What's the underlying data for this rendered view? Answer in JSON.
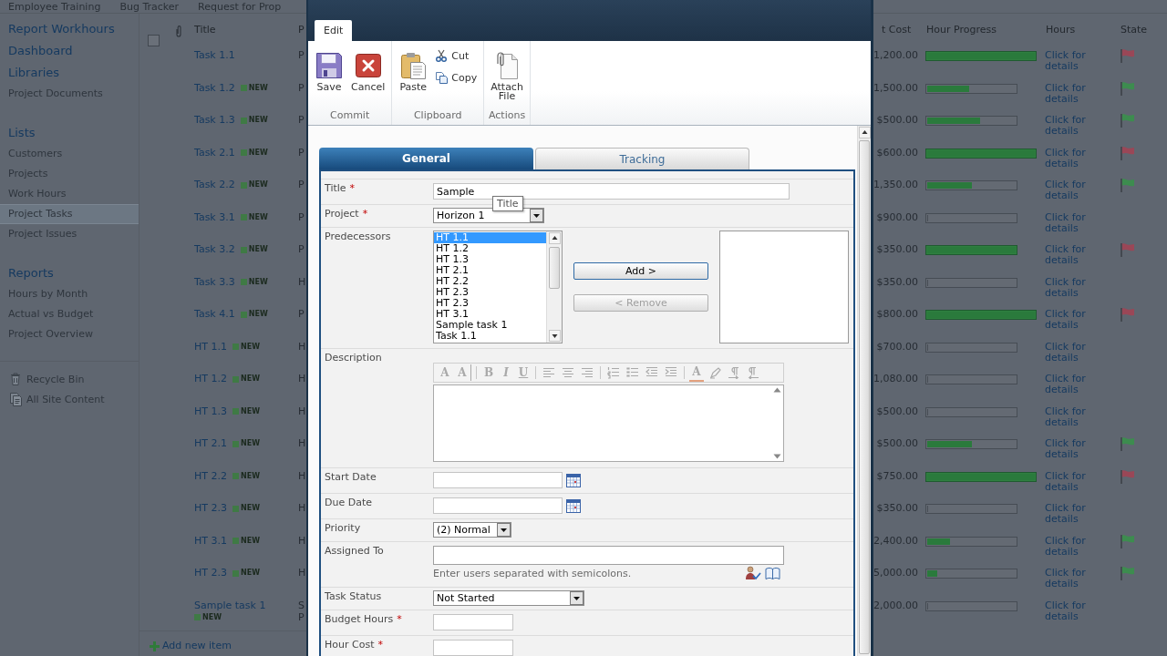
{
  "top_nav": [
    {
      "label": "Employee Training"
    },
    {
      "label": "Bug Tracker"
    },
    {
      "label": "Request for Prop"
    }
  ],
  "sidebar": {
    "groups": [
      {
        "headings": [
          "Report Workhours",
          "Dashboard",
          "Libraries"
        ],
        "items": [
          {
            "label": "Project Documents",
            "selected": false
          }
        ]
      },
      {
        "headings": [
          "Lists"
        ],
        "items": [
          {
            "label": "Customers",
            "selected": false
          },
          {
            "label": "Projects",
            "selected": false
          },
          {
            "label": "Work Hours",
            "selected": false
          },
          {
            "label": "Project Tasks",
            "selected": true
          },
          {
            "label": "Project Issues",
            "selected": false
          }
        ]
      },
      {
        "headings": [
          "Reports"
        ],
        "items": [
          {
            "label": "Hours by Month",
            "selected": false
          },
          {
            "label": "Actual vs Budget",
            "selected": false
          },
          {
            "label": "Project Overview",
            "selected": false
          }
        ]
      }
    ],
    "footer_links": [
      {
        "label": "Recycle Bin",
        "kind": "recycle_bin"
      },
      {
        "label": "All Site Content",
        "kind": "site_content"
      }
    ]
  },
  "list": {
    "select_all": {
      "checked": false
    },
    "columns": {
      "title": "Title",
      "column_2": "P",
      "column_cost": "t Cost",
      "progress": "Hour Progress",
      "hours": "Hours",
      "state": "State"
    },
    "rows": [
      {
        "title": "Task 1.1",
        "column_2": [
          "P"
        ],
        "cost": "1,200.00",
        "level": 1,
        "overrun": true,
        "hours": "Click for details",
        "flag": {
          "color": "#9a4757"
        }
      },
      {
        "title": "Task 1.2",
        "badge": "NEW",
        "column_2": [
          "P"
        ],
        "cost": "1,500.00",
        "level": 0.47,
        "overrun": false,
        "hours": "Click for details",
        "flag": {
          "color": "#3d8c4f"
        }
      },
      {
        "title": "Task 1.3",
        "badge": "NEW",
        "column_2": [
          "P"
        ],
        "cost": "$500.00",
        "level": 0.6,
        "overrun": false,
        "hours": "Click for details",
        "flag": {
          "color": "#3d8c4f"
        }
      },
      {
        "title": "Task 2.1",
        "badge": "NEW",
        "column_2": [
          "P"
        ],
        "cost": "$600.00",
        "level": 1,
        "overrun": true,
        "hours": "Click for details",
        "flag": {
          "color": "#9a4757"
        }
      },
      {
        "title": "Task 2.2",
        "badge": "NEW",
        "column_2": [
          "P"
        ],
        "cost": "1,350.00",
        "level": 0.5,
        "overrun": false,
        "hours": "Click for details",
        "flag": {
          "color": "#3d8c4f"
        }
      },
      {
        "title": "Task 3.1",
        "badge": "NEW",
        "column_2": [
          "P"
        ],
        "cost": "$900.00",
        "level": 0,
        "overrun": false,
        "hours": "Click for details"
      },
      {
        "title": "Task 3.2",
        "badge": "NEW",
        "column_2": [
          "P"
        ],
        "cost": "$350.00",
        "level": 1,
        "overrun": false,
        "hours": "Click for details",
        "flag": {
          "color": "#9a4757"
        }
      },
      {
        "title": "Task 3.3",
        "badge": "NEW",
        "column_2": [
          "H"
        ],
        "cost": "$350.00",
        "level": 0,
        "overrun": false,
        "hours": "Click for details"
      },
      {
        "title": "Task 4.1",
        "badge": "NEW",
        "column_2": [
          "P"
        ],
        "cost": "$800.00",
        "level": 1,
        "overrun": true,
        "hours": "Click for details",
        "flag": {
          "color": "#9a4757"
        }
      },
      {
        "title": "HT 1.1",
        "badge": "NEW",
        "column_2": [
          "H"
        ],
        "cost": "$700.00",
        "level": 0,
        "overrun": false,
        "hours": "Click for details"
      },
      {
        "title": "HT 1.2",
        "badge": "NEW",
        "column_2": [
          "H"
        ],
        "cost": "1,080.00",
        "level": 0,
        "overrun": false,
        "hours": "Click for details"
      },
      {
        "title": "HT 1.3",
        "badge": "NEW",
        "column_2": [
          "H"
        ],
        "cost": "$500.00",
        "level": 0,
        "overrun": false,
        "hours": "Click for details"
      },
      {
        "title": "HT 2.1",
        "badge": "NEW",
        "column_2": [
          "H"
        ],
        "cost": "$500.00",
        "level": 0.5,
        "overrun": false,
        "hours": "Click for details",
        "flag": {
          "color": "#3d8c4f"
        }
      },
      {
        "title": "HT 2.2",
        "badge": "NEW",
        "column_2": [
          "H"
        ],
        "cost": "$750.00",
        "level": 1,
        "overrun": true,
        "hours": "Click for details",
        "flag": {
          "color": "#9a4757"
        }
      },
      {
        "title": "HT 2.3",
        "badge": "NEW",
        "column_2": [
          "H"
        ],
        "cost": "$350.00",
        "level": 0,
        "overrun": false,
        "hours": "Click for details"
      },
      {
        "title": "HT 3.1",
        "badge": "NEW",
        "column_2": [
          "H"
        ],
        "cost": "2,400.00",
        "level": 0.26,
        "overrun": false,
        "hours": "Click for details",
        "flag": {
          "color": "#3d8c4f"
        }
      },
      {
        "title": "HT 2.3",
        "badge": "NEW",
        "column_2": [
          "H"
        ],
        "cost": "5,000.00",
        "level": 0.11,
        "overrun": false,
        "hours": "Click for details",
        "flag": {
          "color": "#3d8c4f"
        }
      },
      {
        "title": "Sample task 1",
        "badge": "NEW",
        "column_2": [
          "S",
          "P"
        ],
        "cost": "2,000.00",
        "level": 0,
        "overrun": false,
        "hours": "Click for details"
      }
    ],
    "add_item": "Add new item"
  },
  "dialog": {
    "ribbon_tabs": [
      {
        "label": "Edit",
        "selected": true
      }
    ],
    "ribbon_groups": [
      {
        "label": "Commit",
        "buttons": [
          {
            "label": "Save",
            "kind": "save"
          },
          {
            "label": "Cancel",
            "kind": "cancel"
          }
        ]
      },
      {
        "label": "Clipboard",
        "buttons": [
          {
            "label": "Paste",
            "kind": "paste"
          },
          {
            "label": "Cut",
            "kind": "cut"
          },
          {
            "label": "Copy",
            "kind": "copy"
          }
        ]
      },
      {
        "label": "Actions",
        "buttons": [
          {
            "label": "Attach File",
            "kind": "attach"
          }
        ]
      }
    ],
    "form_tabs": [
      {
        "label": "General",
        "selected": true
      },
      {
        "label": "Tracking",
        "selected": false
      }
    ],
    "fields": [
      {
        "kind": "text",
        "label": "Title",
        "required_mark": "*",
        "value": "Sample",
        "tooltip": "Title"
      },
      {
        "kind": "select",
        "label": "Project",
        "required_mark": "*",
        "value": "Horizon 1"
      },
      {
        "kind": "picker",
        "label": "Predecessors",
        "options": [
          {
            "label": "HT 1.1",
            "selected": true
          },
          {
            "label": "HT 1.2",
            "selected": false
          },
          {
            "label": "HT 1.3",
            "selected": false
          },
          {
            "label": "HT 2.1",
            "selected": false
          },
          {
            "label": "HT 2.2",
            "selected": false
          },
          {
            "label": "HT 2.3",
            "selected": false
          },
          {
            "label": "HT 2.3",
            "selected": false
          },
          {
            "label": "HT 3.1",
            "selected": false
          },
          {
            "label": "Sample task 1",
            "selected": false
          },
          {
            "label": "Task 1.1",
            "selected": false
          }
        ],
        "buttons": [
          {
            "label": "Add >",
            "disabled": false
          },
          {
            "label": "< Remove",
            "disabled": true
          }
        ]
      },
      {
        "kind": "rich_text",
        "label": "Description",
        "toolbar": {
          "disabled": true,
          "tools": [
            {
              "kind": "font",
              "glyph": "A"
            },
            {
              "kind": "font_size",
              "glyph": "A"
            },
            {
              "kind": "separator"
            },
            {
              "kind": "bold",
              "glyph": "B"
            },
            {
              "kind": "italic",
              "glyph": "I"
            },
            {
              "kind": "underline",
              "glyph": "U"
            },
            {
              "kind": "separator"
            },
            {
              "kind": "align_left"
            },
            {
              "kind": "align_center"
            },
            {
              "kind": "align_right"
            },
            {
              "kind": "separator"
            },
            {
              "kind": "numbered_list"
            },
            {
              "kind": "bulleted_list"
            },
            {
              "kind": "outdent"
            },
            {
              "kind": "indent"
            },
            {
              "kind": "separator"
            },
            {
              "kind": "text_color",
              "glyph": "A"
            },
            {
              "kind": "highlight"
            },
            {
              "kind": "ltr"
            },
            {
              "kind": "rtl"
            }
          ]
        }
      },
      {
        "kind": "date",
        "label": "Start Date"
      },
      {
        "kind": "date",
        "label": "Due Date"
      },
      {
        "kind": "select",
        "label": "Priority",
        "value": "(2) Normal"
      },
      {
        "kind": "people",
        "label": "Assigned To",
        "hint": "Enter users separated with semicolons."
      },
      {
        "kind": "select",
        "label": "Task Status",
        "value": "Not Started"
      },
      {
        "kind": "text",
        "label": "Budget Hours",
        "required_mark": "*"
      },
      {
        "kind": "text",
        "label": "Hour Cost",
        "required_mark": "*"
      }
    ]
  }
}
